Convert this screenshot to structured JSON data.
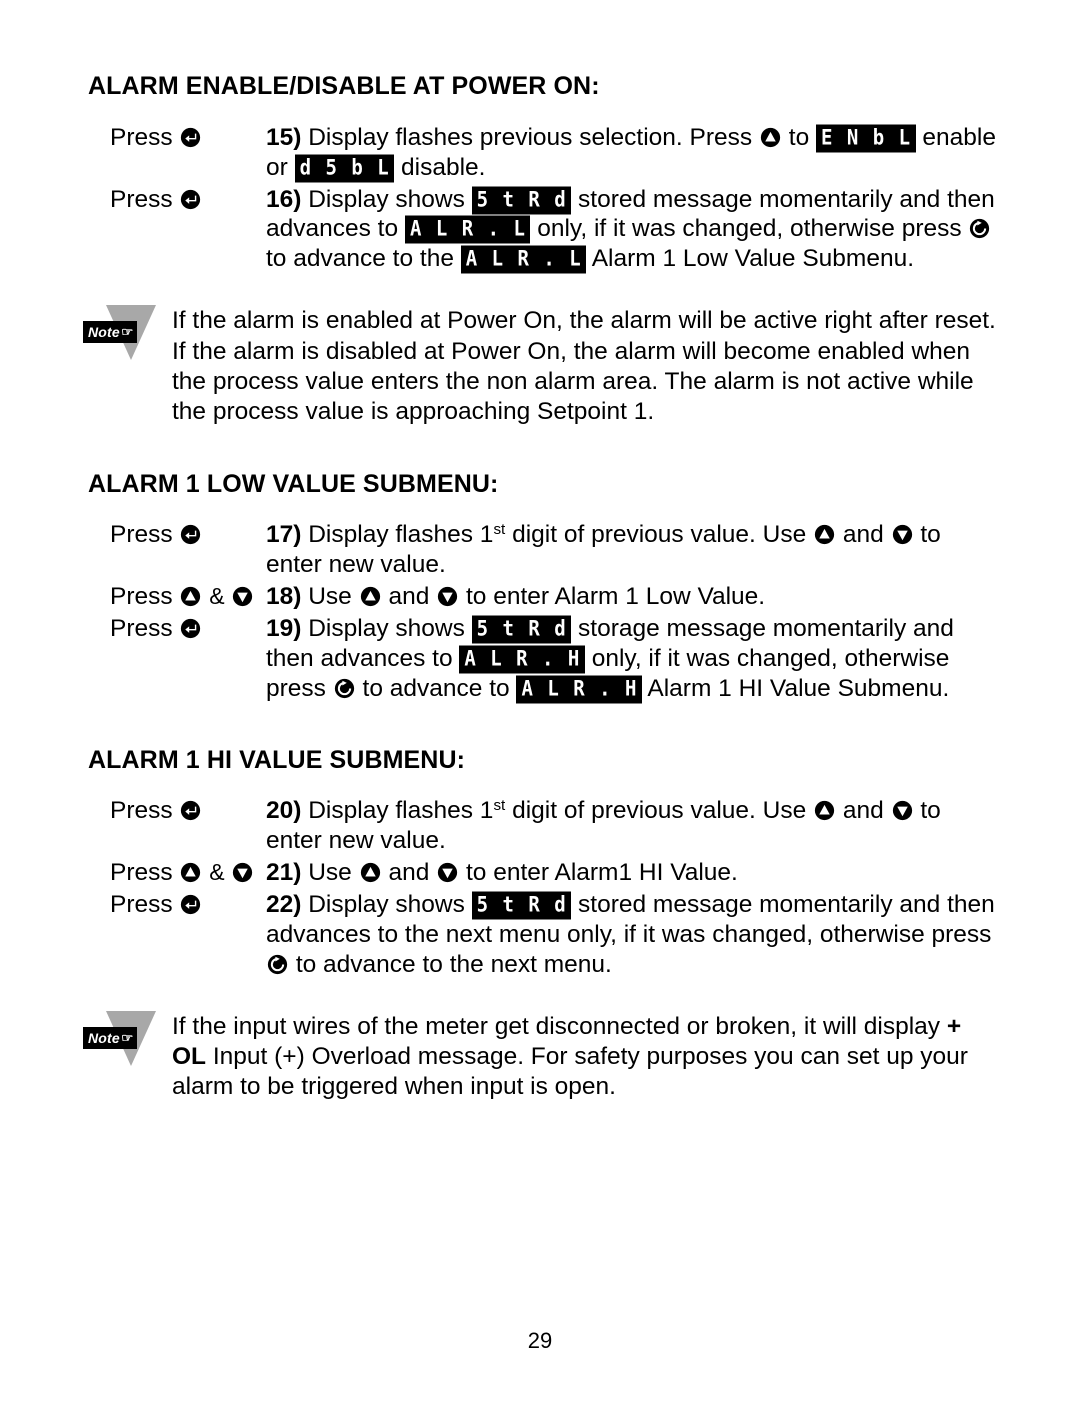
{
  "document": {
    "page_number": "29"
  },
  "icons": {
    "enter": "enter-key-icon",
    "up": "up-arrow-key-icon",
    "down": "down-arrow-key-icon",
    "menu": "menu-advance-key-icon",
    "note_hand": "☞"
  },
  "labels": {
    "press": "Press",
    "ampersand": "&",
    "note": "Note"
  },
  "lcd": {
    "enbl": "E N b L",
    "dsbl": "d 5 b L",
    "strd": "5 t R d",
    "alrl": "A L R . L",
    "alrh": "A L R . H"
  },
  "sections": [
    {
      "id": "alarm-enable-disable-at-power-on",
      "title": "ALARM ENABLE/DISABLE AT POWER ON:",
      "steps": [
        {
          "press": "Press",
          "press_keys": [
            "enter"
          ],
          "number": "15)",
          "lines": [
            "Display flashes previous selection. Press",
            "to",
            "enable",
            "or",
            "disable."
          ]
        },
        {
          "press": "Press",
          "press_keys": [
            "enter"
          ],
          "number": "16)",
          "lines": [
            "Display shows",
            "stored message momentarily and then advances to",
            "only, if it was changed, otherwise press",
            "to advance to the",
            "Alarm 1 Low Value Submenu."
          ]
        }
      ]
    },
    {
      "id": "alarm-1-low-value-submenu",
      "title": "ALARM 1 LOW VALUE SUBMENU:",
      "steps": [
        {
          "press": "Press",
          "press_keys": [
            "enter"
          ],
          "number": "17)",
          "lines": [
            "Display flashes 1",
            "st",
            "digit of previous value. Use",
            "and",
            "to enter new value."
          ]
        },
        {
          "press": "Press",
          "press_keys": [
            "up",
            "down"
          ],
          "number": "18)",
          "lines": [
            "Use",
            "and",
            "to enter Alarm 1 Low Value."
          ]
        },
        {
          "press": "Press",
          "press_keys": [
            "enter"
          ],
          "number": "19)",
          "lines": [
            "Display shows",
            "storage message momentarily and then advances to",
            "only, if it was changed, otherwise press",
            "to advance to",
            "Alarm 1 HI Value Submenu."
          ]
        }
      ]
    },
    {
      "id": "alarm-1-hi-value-submenu",
      "title": "ALARM 1 HI VALUE SUBMENU:",
      "steps": [
        {
          "press": "Press",
          "press_keys": [
            "enter"
          ],
          "number": "20)",
          "lines": [
            "Display flashes 1",
            "st",
            "digit of previous value. Use",
            "and",
            "to enter new value."
          ]
        },
        {
          "press": "Press",
          "press_keys": [
            "up",
            "down"
          ],
          "number": "21)",
          "lines": [
            "Use",
            "and",
            "to enter Alarm1 HI Value."
          ]
        },
        {
          "press": "Press",
          "press_keys": [
            "enter"
          ],
          "number": "22)",
          "lines": [
            "Display shows",
            "stored message momentarily and then advances to the next menu only, if it was changed, otherwise press",
            "to advance to the next menu."
          ]
        }
      ]
    }
  ],
  "notes": [
    {
      "id": "note-power-on-alarm",
      "text": "If the alarm is enabled at Power On, the alarm will be active right after reset. If the alarm is disabled at Power On, the alarm will become enabled when the process value enters the non alarm area. The alarm is not active while the process value is approaching Setpoint 1."
    },
    {
      "id": "note-open-input-overload",
      "text_before": "If the input wires of the meter get disconnected or broken, it will display ",
      "bold_text": "+ OL",
      "text_after": " Input (+) Overload message. For safety purposes you can set up your alarm to be triggered when input is open."
    }
  ],
  "step_text": {
    "s15_a": "Display flashes previous selection. Press",
    "s15_b": "to",
    "s15_c": "enable",
    "s15_d": "or",
    "s15_e": "disable.",
    "s16_a": "Display shows",
    "s16_b": "stored message momentarily and then advances to",
    "s16_c": "only, if it was changed, otherwise press",
    "s16_d": "to advance to the",
    "s16_e": "Alarm 1 Low Value Submenu.",
    "s17_a": "Display flashes 1",
    "s17_sup": "st",
    "s17_b": "digit of previous value. Use",
    "s17_c": "and",
    "s17_d": "to enter new value.",
    "s18_a": "Use",
    "s18_b": "and",
    "s18_c": "to enter Alarm 1 Low Value.",
    "s19_a": "Display shows",
    "s19_b": "storage message momentarily and then advances to",
    "s19_c": "only, if it was changed, otherwise press",
    "s19_d": "to advance to",
    "s19_e": "Alarm 1 HI Value Submenu.",
    "s20_a": "Display flashes 1",
    "s20_sup": "st",
    "s20_b": "digit of previous value. Use",
    "s20_c": "and",
    "s20_d": "to enter new value.",
    "s21_a": "Use",
    "s21_b": "and",
    "s21_c": "to enter Alarm1 HI Value.",
    "s22_a": "Display shows",
    "s22_b": "stored message momentarily and then advances to the next menu only, if it was changed, otherwise",
    "s22_c": "press",
    "s22_d": "to advance to the next menu."
  }
}
